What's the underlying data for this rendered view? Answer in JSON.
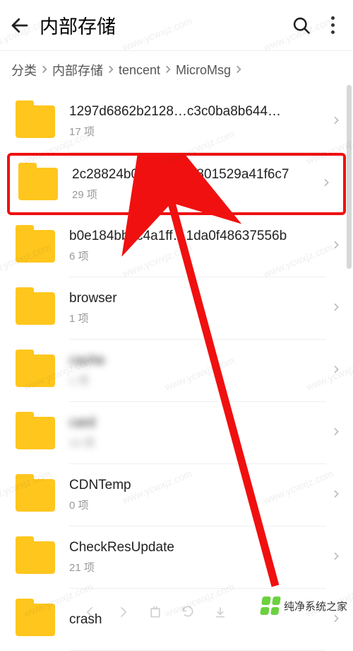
{
  "header": {
    "title": "内部存储"
  },
  "breadcrumb": [
    "分类",
    "内部存储",
    "tencent",
    "MicroMsg"
  ],
  "folders": [
    {
      "name": "1297d6862b2128…c3c0ba8b644d72",
      "sub": "17 项",
      "highlighted": false,
      "blur": false
    },
    {
      "name": "2c28824b0935ab…5801529a41f6c7",
      "sub": "29 项",
      "highlighted": true,
      "blur": false
    },
    {
      "name": "b0e184bbdc4a1ff…1da0f48637556b",
      "sub": "6 项",
      "highlighted": false,
      "blur": false
    },
    {
      "name": "browser",
      "sub": "1 项",
      "highlighted": false,
      "blur": false
    },
    {
      "name": "cache",
      "sub": "1 项",
      "highlighted": false,
      "blur": true
    },
    {
      "name": "card",
      "sub": "10 项",
      "highlighted": false,
      "blur": true
    },
    {
      "name": "CDNTemp",
      "sub": "0 项",
      "highlighted": false,
      "blur": false
    },
    {
      "name": "CheckResUpdate",
      "sub": "21 项",
      "highlighted": false,
      "blur": false
    },
    {
      "name": "crash",
      "sub": "",
      "highlighted": false,
      "blur": false
    }
  ],
  "watermark_text": "www.ycwxjz.com",
  "brand": {
    "name": "纯净系统之家"
  }
}
